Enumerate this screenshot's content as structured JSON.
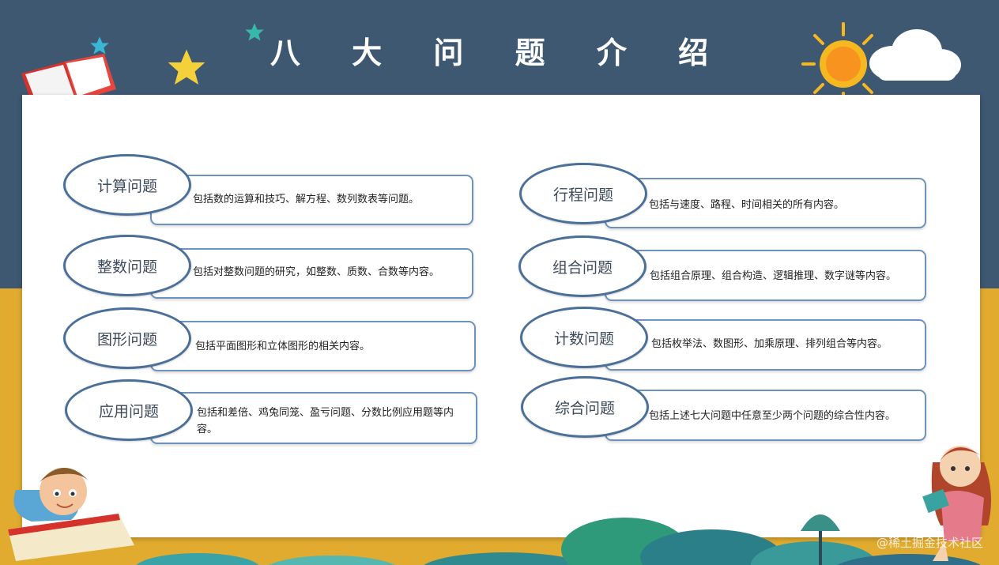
{
  "title": "八 大 问 题 介 绍",
  "cards": [
    {
      "name": "计算问题",
      "desc": "包括数的运算和技巧、解方程、数列数表等问题。"
    },
    {
      "name": "整数问题",
      "desc": "包括对整数问题的研究，如整数、质数、合数等内容。"
    },
    {
      "name": "图形问题",
      "desc": "包括平面图形和立体图形的相关内容。"
    },
    {
      "name": "应用问题",
      "desc": "包括和差倍、鸡兔同笼、盈亏问题、分数比例应用题等内容。"
    },
    {
      "name": "行程问题",
      "desc": "包括与速度、路程、时间相关的所有内容。"
    },
    {
      "name": "组合问题",
      "desc": "包括组合原理、组合构造、逻辑推理、数字谜等内容。"
    },
    {
      "name": "计数问题",
      "desc": "包括枚举法、数图形、加乘原理、排列组合等内容。"
    },
    {
      "name": "综合问题",
      "desc": "包括上述七大问题中任意至少两个问题的综合性内容。"
    }
  ],
  "watermark": "@稀土掘金技术社区",
  "colors": {
    "header_bg": "#3e5872",
    "footer_bg": "#e1ab2f",
    "card_border": "#6d93bd",
    "oval_border": "#4a6f98"
  },
  "icons": [
    "book-icon",
    "star-icon",
    "sun-icon",
    "cloud-icon",
    "boy-illustration",
    "girl-illustration"
  ]
}
